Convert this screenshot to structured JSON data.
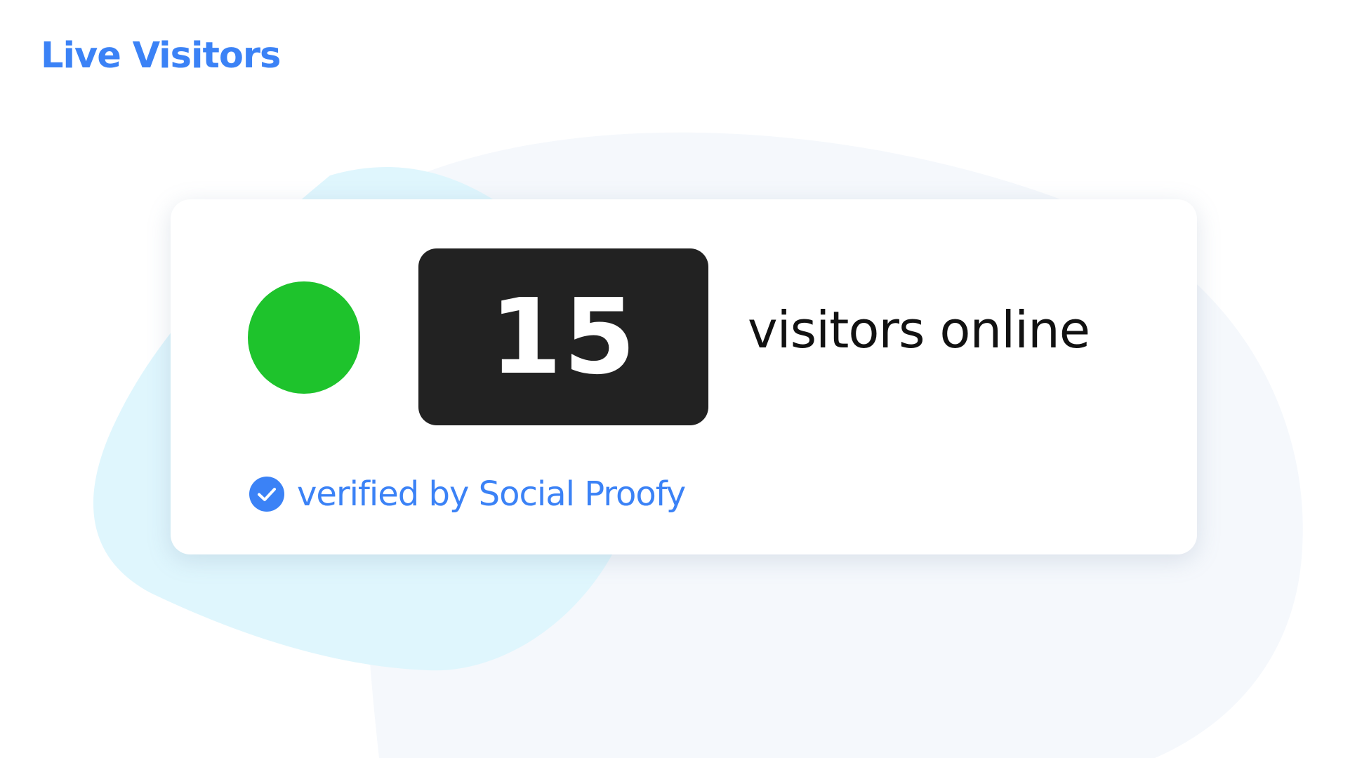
{
  "page": {
    "title": "Live Visitors"
  },
  "widget": {
    "count": "15",
    "label": "visitors online",
    "verified_text": "verified by Social Proofy"
  },
  "icons": {
    "status": "status-dot-icon",
    "verified": "check-circle-icon"
  },
  "colors": {
    "accent": "#3b82f6",
    "status": "#1ec32c",
    "counter_bg": "#222222",
    "blob_left": "#dff6fd",
    "blob_right": "#f5f8fc"
  }
}
